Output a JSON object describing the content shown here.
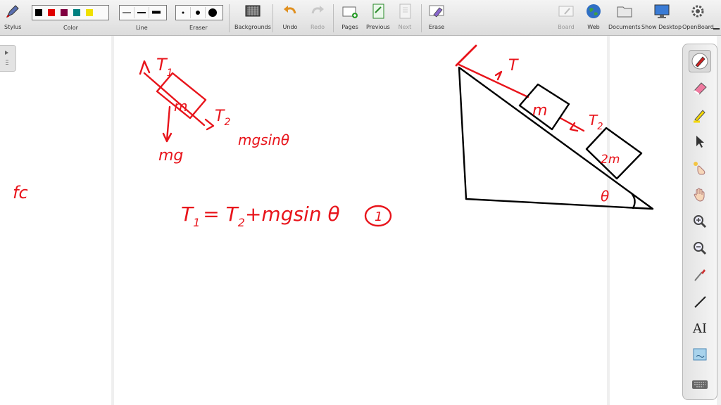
{
  "toolbar": {
    "stylus": "Stylus",
    "color": "Color",
    "line": "Line",
    "eraser": "Eraser",
    "backgrounds": "Backgrounds",
    "undo": "Undo",
    "redo": "Redo",
    "pages": "Pages",
    "previous": "Previous",
    "next": "Next",
    "erase": "Erase",
    "board": "Board",
    "web": "Web",
    "documents": "Documents",
    "show_desktop": "Show Desktop",
    "openboard": "OpenBoard"
  },
  "colors": {
    "black": "#000000",
    "red": "#e00000",
    "maroon": "#800040",
    "teal": "#008080",
    "yellow": "#f0e000",
    "ink": "#e8141b"
  },
  "right_toolbar": {
    "text_tool_glyph": "AI",
    "icons": [
      "pen-icon",
      "eraser-icon",
      "marker-icon",
      "pointer-icon",
      "laser-pointer-icon",
      "hand-icon",
      "zoom-in-icon",
      "zoom-out-icon",
      "capture-icon",
      "line-icon",
      "text-icon",
      "screenshot-icon",
      "keyboard-icon"
    ]
  },
  "canvas": {
    "lbl_T1": "T",
    "lbl_T1_sub": "1",
    "lbl_m_small": "m",
    "lbl_T2": "T",
    "lbl_T2_sub": "2",
    "lbl_mgsin": "mgsinθ",
    "lbl_mg": "mg",
    "lbl_fc": "fc",
    "eq_T1": "T",
    "eq_T1_sub": "1",
    "eq_rest": "= T",
    "eq_T2_sub": "2",
    "eq_tail": "+mgsin θ",
    "eq_num": "1",
    "lbl_T_top": "T",
    "lbl_m_big": "m",
    "lbl_T2b": "T",
    "lbl_T2b_sub": "2",
    "lbl_2m": "2m",
    "lbl_theta": "θ"
  }
}
